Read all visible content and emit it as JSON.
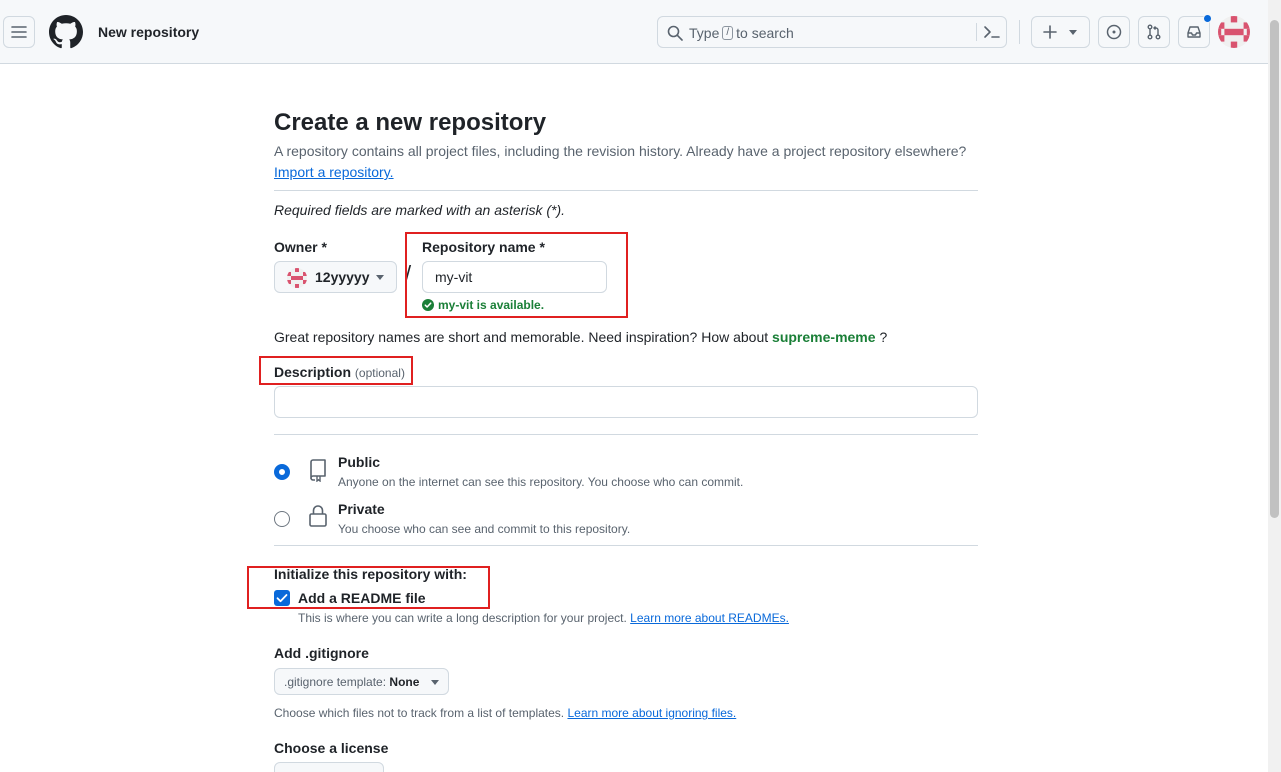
{
  "header": {
    "title": "New repository",
    "search_prefix": "Type",
    "search_key": "/",
    "search_suffix": "to search"
  },
  "page": {
    "heading": "Create a new repository",
    "intro": "A repository contains all project files, including the revision history. Already have a project repository elsewhere?",
    "import_link": "Import a repository.",
    "required_note": "Required fields are marked with an asterisk (*)."
  },
  "owner": {
    "label": "Owner *",
    "value": "12yyyyy"
  },
  "repo_name": {
    "label": "Repository name *",
    "value": "my-vit",
    "availability": "my-vit is available."
  },
  "inspiration": {
    "text": "Great repository names are short and memorable. Need inspiration? How about",
    "suggestion": "supreme-meme",
    "tail": "?"
  },
  "description": {
    "label": "Description",
    "optional": "(optional)",
    "value": ""
  },
  "visibility": {
    "public_title": "Public",
    "public_desc": "Anyone on the internet can see this repository. You choose who can commit.",
    "private_title": "Private",
    "private_desc": "You choose who can see and commit to this repository.",
    "selected": "Public"
  },
  "initialize": {
    "label": "Initialize this repository with:",
    "readme_label": "Add a README file",
    "readme_checked": true,
    "readme_hint": "This is where you can write a long description for your project.",
    "readme_link": "Learn more about READMEs."
  },
  "gitignore": {
    "label": "Add .gitignore",
    "select_prefix": ".gitignore template:",
    "select_value": "None",
    "hint": "Choose which files not to track from a list of templates.",
    "hint_link": "Learn more about ignoring files."
  },
  "license": {
    "label": "Choose a license"
  },
  "colors": {
    "accent": "#0969da",
    "success": "#1a7f37",
    "annotation": "#e02020"
  }
}
